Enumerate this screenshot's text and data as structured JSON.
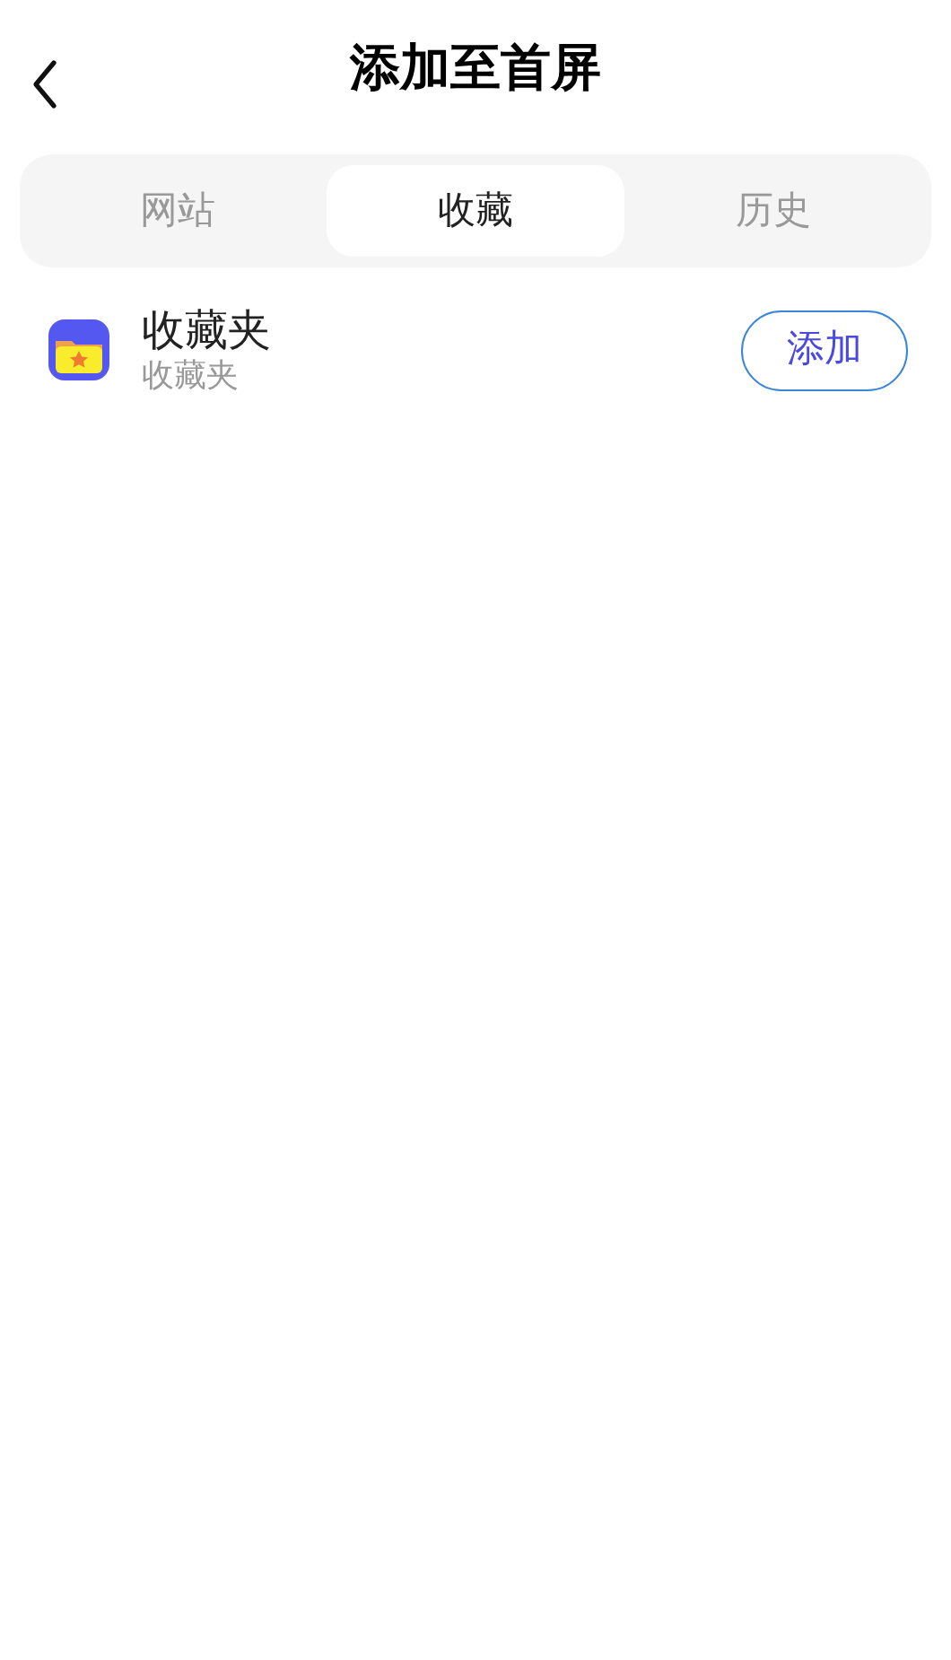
{
  "header": {
    "title": "添加至首屏"
  },
  "tabs": [
    {
      "label": "网站",
      "selected": false
    },
    {
      "label": "收藏",
      "selected": true
    },
    {
      "label": "历史",
      "selected": false
    }
  ],
  "items": [
    {
      "title": "收藏夹",
      "subtitle": "收藏夹",
      "button": "添加"
    }
  ]
}
